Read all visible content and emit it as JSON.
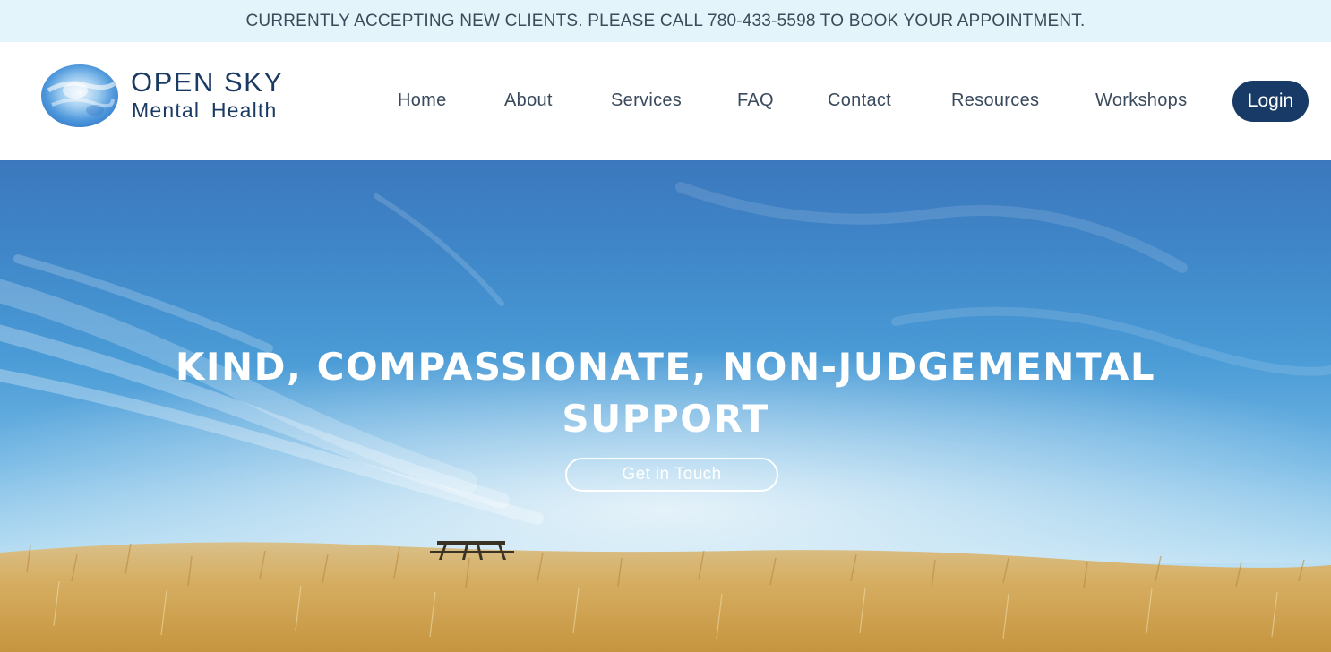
{
  "announcement": {
    "text": "CURRENTLY ACCEPTING NEW CLIENTS. PLEASE CALL 780-433-5598 TO BOOK YOUR APPOINTMENT."
  },
  "brand": {
    "title": "OPEN SKY",
    "subtitle": "Mental Health",
    "logo_icon": "watercolor-circle-logo"
  },
  "nav": {
    "items": [
      {
        "label": "Home"
      },
      {
        "label": "About"
      },
      {
        "label": "Services"
      },
      {
        "label": "FAQ"
      },
      {
        "label": "Contact"
      },
      {
        "label": "Resources"
      },
      {
        "label": "Workshops"
      }
    ],
    "login_label": "Login"
  },
  "hero": {
    "title_line1": "KIND, COMPASSIONATE, NON-JUDGEMENTAL",
    "title_line2": "SUPPORT",
    "cta_label": "Get in Touch",
    "background": "blue sky over golden wheat field with picnic table"
  },
  "colors": {
    "announcement_bg": "#e3f4fb",
    "brand_navy": "#1b3a63",
    "login_bg": "#173a66",
    "sky_blue": "#4a9bd6",
    "field_gold": "#d8b36a"
  }
}
